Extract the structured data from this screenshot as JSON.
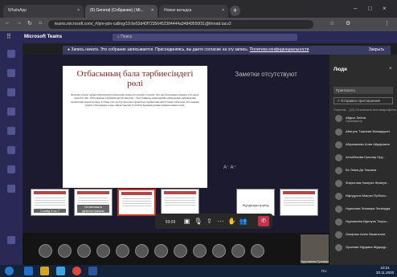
{
  "browser": {
    "tabs": [
      {
        "label": "WhatsApp"
      },
      {
        "label": "(5) General (Собрание) | Mi..."
      },
      {
        "label": "Новая вкладка"
      }
    ],
    "new_tab": "+",
    "url": "teams.microsoft.com/_#/pre-join-calling/19:6e53d40f72356452384444a34849550f31@thread.tacv2",
    "window_controls": [
      "–",
      "□",
      "×"
    ]
  },
  "teams": {
    "app_name": "Microsoft Teams",
    "search_placeholder": "Поиск",
    "notice": {
      "text": "Запись начата. Это собрание записывается. Присоединяясь, вы даете согласие на эту запись.",
      "link": "Политика конфиденциальности",
      "dismiss": "Закрыть"
    },
    "document": {
      "title": "Отбасының бала тәрбиесіндегі рөлі",
      "body": "Балалар отбасы тәрбиесінің шешуші рөлін қазақ халқы өте ертеден түсінген. Ата-ана баласының алдында үлгі-өнеге көрсетуі тиіс. Отбасындағы тәрбиенің негізгі мақсаты – бала бойында адамгершілік, имандылық, еңбекқорлық қасиеттерін қалыптастыру. Ұлттық салт-дәстүр мен әдет-ғұрып бала тәрбиесінің негізі болып табылады. Ата-ананың беделі, отбасындағы өзара сыйластық пен түсіністік баланың рухани дамуына ықпал етеді."
    },
    "notes_empty": "Заметки отсутствуют",
    "zoom_controls": "A⁻   A⁺",
    "thumbnails": [
      {
        "caption": "Слайд 6 из 7"
      },
      {
        "caption": "Остановить демонстрацию"
      },
      {
        "caption": ""
      },
      {
        "caption": ""
      },
      {
        "caption": "Жұлдызды қорғау"
      },
      {
        "caption": ""
      },
      {
        "caption": ""
      }
    ],
    "call": {
      "timer": "59:09",
      "hangup_icon": "phone-hangup-icon"
    },
    "self_view_name": "Нурусимова Гульмира...",
    "people_panel": {
      "title": "Люди",
      "invite_placeholder": "Пригласить",
      "share_invite": "Отправка приглашения",
      "section": "Участни... (13)   Отключить все микрофоны",
      "participants": [
        {
          "name": "Абдыл Лейла",
          "role": "Организатор"
        },
        {
          "name": "Айнгуль Тәжиева Жомардтегі..."
        },
        {
          "name": "Абулмахова Алия Айдаровна"
        },
        {
          "name": "Ахтыбекова Гульнар Ору..."
        },
        {
          "name": "Бе Элма Да Таковна"
        },
        {
          "name": "Жауытова Назерке Жазере..."
        },
        {
          "name": "Ифлдұлла Мақтал Ерболы..."
        },
        {
          "name": "Нурыхова Эльмира Элизарда..."
        },
        {
          "name": "Нуркишева Идилуль Таңсы..."
        },
        {
          "name": "Оморова Асем Заманхана"
        },
        {
          "name": "Оралова Нурдана Жудыдр..."
        }
      ]
    }
  },
  "taskbar": {
    "language": "RU",
    "time": "10:21",
    "date": "20.11.2020"
  },
  "colors": {
    "teams_purple": "#2a2955",
    "title_red": "#8a1d1d",
    "hangup_red": "#c4314b"
  }
}
